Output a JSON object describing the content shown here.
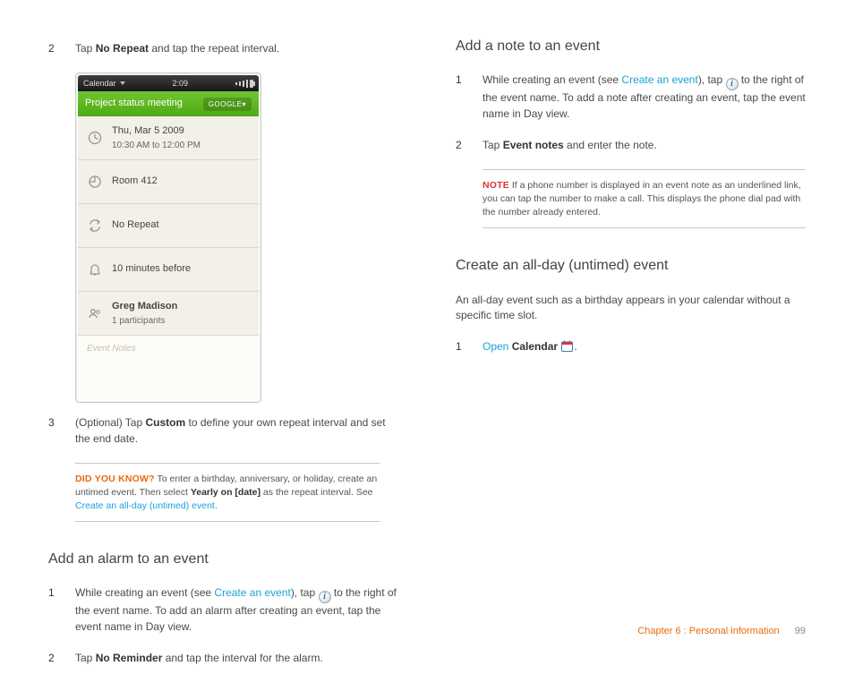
{
  "left": {
    "step2_num": "2",
    "step2_a": "Tap ",
    "step2_bold": "No Repeat",
    "step2_b": " and tap the repeat interval.",
    "step3_num": "3",
    "step3_a": "(Optional) Tap ",
    "step3_bold": "Custom",
    "step3_b": " to define your own repeat interval and set the end date.",
    "dyk_lead": "DID YOU KNOW?",
    "dyk_a": "To enter a birthday, anniversary, or holiday, create an untimed event. Then select ",
    "dyk_bold": "Yearly on [date]",
    "dyk_b": " as the repeat interval. See ",
    "dyk_link": "Create an all-day (untimed) event",
    "dyk_c": ".",
    "alarm_title": "Add an alarm to an event",
    "alarm1_num": "1",
    "alarm1_a": "While creating an event (see ",
    "alarm1_link": "Create an event",
    "alarm1_b": "), tap ",
    "alarm1_c": " to the right of the event name. To add an alarm after creating an event, tap the event name in Day view.",
    "alarm2_num": "2",
    "alarm2_a": "Tap ",
    "alarm2_bold": "No Reminder",
    "alarm2_b": " and tap the interval for the alarm."
  },
  "right": {
    "note_title": "Add a note to an event",
    "note1_num": "1",
    "note1_a": "While creating an event (see ",
    "note1_link": "Create an event",
    "note1_b": "), tap ",
    "note1_c": " to the right of the event name. To add a note after creating an event, tap the event name in Day view.",
    "note2_num": "2",
    "note2_a": "Tap ",
    "note2_bold": "Event notes",
    "note2_b": " and enter the note.",
    "callout_lead": "NOTE",
    "callout_body": "If a phone number is displayed in an event note as an underlined link, you can tap the number to make a call. This displays the phone dial pad with the number already entered.",
    "allday_title": "Create an all-day (untimed) event",
    "allday_intro": "An all-day event such as a birthday appears in your calendar without a specific time slot.",
    "allday1_num": "1",
    "allday1_link": "Open",
    "allday1_bold": "Calendar",
    "allday1_end": "."
  },
  "phone": {
    "app": "Calendar",
    "time": "2:09",
    "title": "Project status meeting",
    "tag": "GOOGLE▾",
    "row_date_main": "Thu, Mar 5 2009",
    "row_date_sub": "10:30 AM to 12:00 PM",
    "row_room": "Room 412",
    "row_repeat": "No Repeat",
    "row_reminder": "10 minutes before",
    "row_person": "Greg Madison",
    "row_person_sub": "1 participants",
    "notes_placeholder": "Event Notes"
  },
  "footer": {
    "chapter": "Chapter 6 : Personal information",
    "page": "99"
  }
}
